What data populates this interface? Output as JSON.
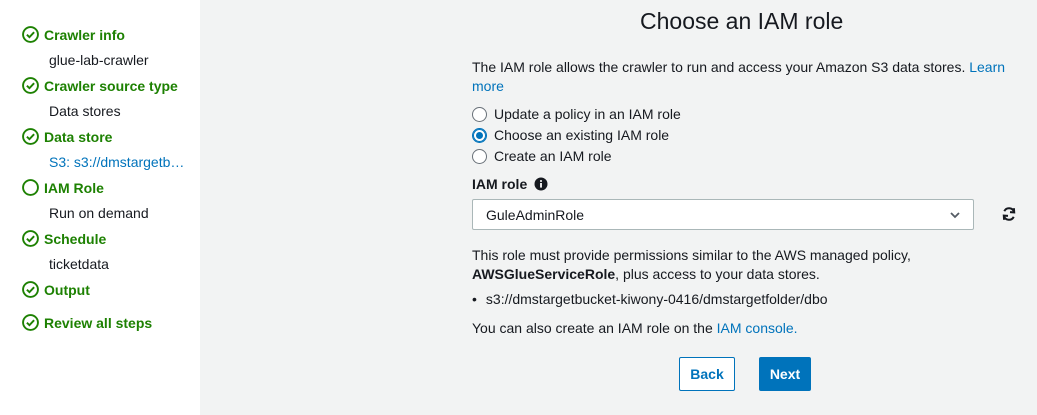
{
  "sidebar": {
    "steps": [
      {
        "label": "Crawler info",
        "value": "glue-lab-crawler",
        "status": "complete"
      },
      {
        "label": "Crawler source type",
        "value": "Data stores",
        "status": "complete"
      },
      {
        "label": "Data store",
        "value": "S3: s3://dmstargetb…",
        "status": "complete"
      },
      {
        "label": "IAM Role",
        "value": "Run on demand",
        "status": "current"
      },
      {
        "label": "Schedule",
        "value": "ticketdata",
        "status": "complete"
      },
      {
        "label": "Output",
        "value": "",
        "status": "complete"
      },
      {
        "label": "Review all steps",
        "value": "",
        "status": "complete"
      }
    ]
  },
  "main": {
    "title": "Choose an IAM role",
    "description": "The IAM role allows the crawler to run and access your Amazon S3 data stores.",
    "learn_more": "Learn more",
    "radio_options": [
      {
        "label": "Update a policy in an IAM role",
        "checked": false
      },
      {
        "label": "Choose an existing IAM role",
        "checked": true
      },
      {
        "label": "Create an IAM role",
        "checked": false
      }
    ],
    "iam_role_label": "IAM role",
    "iam_role_value": "GuleAdminRole",
    "note_prefix": "This role must provide permissions similar to the AWS managed policy,",
    "note_policy": "AWSGlueServiceRole",
    "note_suffix": ", plus access to your data stores.",
    "bullet_path": "s3://dmstargetbucket-kiwony-0416/dmstargetfolder/dbo",
    "console_text": "You can also create an IAM role on the",
    "console_link": "IAM console.",
    "back_label": "Back",
    "next_label": "Next"
  },
  "colors": {
    "success": "#1d8102",
    "link": "#0073bb",
    "primary": "#0073bb",
    "background": "#f2f3f3"
  }
}
